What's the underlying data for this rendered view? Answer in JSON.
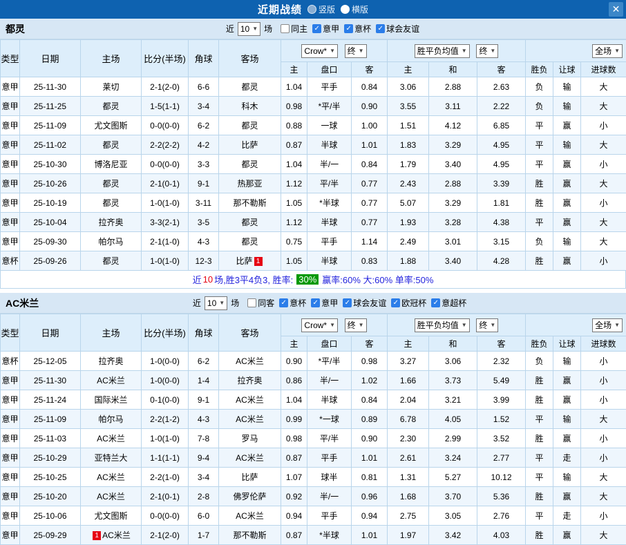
{
  "titlebar": {
    "title": "近期战绩",
    "radio_vertical": "竖版",
    "radio_horizontal": "横版",
    "selected_layout": "横版"
  },
  "icons": {
    "dropdown_arrow": "▼",
    "check_icon": "✓",
    "close_icon": "✕"
  },
  "colors": {
    "accent_blue": "#0e62b0",
    "header_bg": "#ddeefb",
    "team_green": "#089b2d",
    "win_red": "#e60012",
    "draw_blue": "#2222e0",
    "cup_purple": "#8833cc",
    "rate_badge_green": "#009900"
  },
  "columns": {
    "type": "类型",
    "date": "日期",
    "home": "主场",
    "score": "比分(半场)",
    "corner": "角球",
    "away": "客场",
    "sub": [
      "主",
      "盘口",
      "客",
      "主",
      "和",
      "客",
      "胜负",
      "让球",
      "进球数"
    ],
    "dd_crown": "Crow*",
    "dd_final": "终",
    "dd_avg": "胜平负均值",
    "dd_full": "全场"
  },
  "table1": {
    "team": "都灵",
    "near": {
      "label_before": "近",
      "value": "10",
      "label_after": "场"
    },
    "filters": [
      {
        "label": "同主",
        "checked": false
      },
      {
        "label": "意甲",
        "checked": true
      },
      {
        "label": "意杯",
        "checked": true
      },
      {
        "label": "球会友谊",
        "checked": true
      }
    ],
    "rows": [
      {
        "type": "意甲",
        "type_c": "b",
        "date": "25-11-30",
        "home": "莱切",
        "home_focal": false,
        "home_badge": "",
        "score": "2-1(2-0)",
        "score_c": "r",
        "corner": "6-6",
        "away": "都灵",
        "away_focal": true,
        "away_badge": "",
        "odds": [
          "1.04",
          "平手",
          "0.84"
        ],
        "avg": [
          "3.06",
          "2.88",
          "2.63"
        ],
        "res": "负",
        "res_c": "g",
        "let": "输",
        "let_c": "g",
        "goal": "大",
        "goal_c": "r"
      },
      {
        "type": "意甲",
        "type_c": "b",
        "date": "25-11-25",
        "home": "都灵",
        "home_focal": true,
        "home_badge": "",
        "score": "1-5(1-1)",
        "score_c": "r",
        "corner": "3-4",
        "away": "科木",
        "away_focal": false,
        "away_badge": "",
        "odds": [
          "0.98",
          "*平/半",
          "0.90"
        ],
        "avg": [
          "3.55",
          "3.11",
          "2.22"
        ],
        "res": "负",
        "res_c": "g",
        "let": "输",
        "let_c": "g",
        "goal": "大",
        "goal_c": "r"
      },
      {
        "type": "意甲",
        "type_c": "b",
        "date": "25-11-09",
        "home": "尤文图斯",
        "home_focal": false,
        "home_badge": "",
        "score": "0-0(0-0)",
        "score_c": "b",
        "corner": "6-2",
        "away": "都灵",
        "away_focal": true,
        "away_badge": "",
        "odds": [
          "0.88",
          "一球",
          "1.00"
        ],
        "avg": [
          "1.51",
          "4.12",
          "6.85"
        ],
        "res": "平",
        "res_c": "b",
        "let": "赢",
        "let_c": "r",
        "goal": "小",
        "goal_c": "g"
      },
      {
        "type": "意甲",
        "type_c": "b",
        "date": "25-11-02",
        "home": "都灵",
        "home_focal": true,
        "home_badge": "",
        "score": "2-2(2-2)",
        "score_c": "r",
        "corner": "4-2",
        "away": "比萨",
        "away_focal": false,
        "away_badge": "",
        "odds": [
          "0.87",
          "半球",
          "1.01"
        ],
        "avg": [
          "1.83",
          "3.29",
          "4.95"
        ],
        "res": "平",
        "res_c": "b",
        "let": "输",
        "let_c": "g",
        "goal": "大",
        "goal_c": "r"
      },
      {
        "type": "意甲",
        "type_c": "b",
        "date": "25-10-30",
        "home": "博洛尼亚",
        "home_focal": false,
        "home_badge": "",
        "score": "0-0(0-0)",
        "score_c": "b",
        "corner": "3-3",
        "away": "都灵",
        "away_focal": true,
        "away_badge": "",
        "odds": [
          "1.04",
          "半/一",
          "0.84"
        ],
        "avg": [
          "1.79",
          "3.40",
          "4.95"
        ],
        "res": "平",
        "res_c": "b",
        "let": "赢",
        "let_c": "r",
        "goal": "小",
        "goal_c": "g"
      },
      {
        "type": "意甲",
        "type_c": "b",
        "date": "25-10-26",
        "home": "都灵",
        "home_focal": true,
        "home_badge": "",
        "score": "2-1(0-1)",
        "score_c": "r",
        "corner": "9-1",
        "away": "热那亚",
        "away_focal": false,
        "away_badge": "",
        "odds": [
          "1.12",
          "平/半",
          "0.77"
        ],
        "avg": [
          "2.43",
          "2.88",
          "3.39"
        ],
        "res": "胜",
        "res_c": "r",
        "let": "赢",
        "let_c": "r",
        "goal": "大",
        "goal_c": "r"
      },
      {
        "type": "意甲",
        "type_c": "b",
        "date": "25-10-19",
        "home": "都灵",
        "home_focal": true,
        "home_badge": "",
        "score": "1-0(1-0)",
        "score_c": "r",
        "corner": "3-11",
        "away": "那不勒斯",
        "away_focal": false,
        "away_badge": "",
        "odds": [
          "1.05",
          "*半球",
          "0.77"
        ],
        "avg": [
          "5.07",
          "3.29",
          "1.81"
        ],
        "res": "胜",
        "res_c": "r",
        "let": "赢",
        "let_c": "r",
        "goal": "小",
        "goal_c": "g"
      },
      {
        "type": "意甲",
        "type_c": "b",
        "date": "25-10-04",
        "home": "拉齐奥",
        "home_focal": false,
        "home_badge": "",
        "score": "3-3(2-1)",
        "score_c": "r",
        "corner": "3-5",
        "away": "都灵",
        "away_focal": true,
        "away_badge": "",
        "odds": [
          "1.12",
          "半球",
          "0.77"
        ],
        "avg": [
          "1.93",
          "3.28",
          "4.38"
        ],
        "res": "平",
        "res_c": "b",
        "let": "赢",
        "let_c": "r",
        "goal": "大",
        "goal_c": "r"
      },
      {
        "type": "意甲",
        "type_c": "b",
        "date": "25-09-30",
        "home": "帕尔马",
        "home_focal": false,
        "home_badge": "",
        "score": "2-1(1-0)",
        "score_c": "r",
        "corner": "4-3",
        "away": "都灵",
        "away_focal": true,
        "away_badge": "",
        "odds": [
          "0.75",
          "平手",
          "1.14"
        ],
        "avg": [
          "2.49",
          "3.01",
          "3.15"
        ],
        "res": "负",
        "res_c": "g",
        "let": "输",
        "let_c": "g",
        "goal": "大",
        "goal_c": "r"
      },
      {
        "type": "意杯",
        "type_c": "p",
        "date": "25-09-26",
        "home": "都灵",
        "home_focal": true,
        "home_badge": "",
        "score": "1-0(1-0)",
        "score_c": "r",
        "corner": "12-3",
        "away": "比萨",
        "away_focal": false,
        "away_badge": "1",
        "odds": [
          "1.05",
          "半球",
          "0.83"
        ],
        "avg": [
          "1.88",
          "3.40",
          "4.28"
        ],
        "res": "胜",
        "res_c": "r",
        "let": "赢",
        "let_c": "r",
        "goal": "小",
        "goal_c": "g"
      }
    ],
    "summary": {
      "prefix": "近",
      "count": "10",
      "mid": "场,胜3平4负3, 胜率:",
      "rate": "30%",
      "tail": "赢率:60% 大:60% 单率:50%"
    }
  },
  "table2": {
    "team": "AC米兰",
    "near": {
      "label_before": "近",
      "value": "10",
      "label_after": "场"
    },
    "filters": [
      {
        "label": "同客",
        "checked": false
      },
      {
        "label": "意杯",
        "checked": true
      },
      {
        "label": "意甲",
        "checked": true
      },
      {
        "label": "球会友谊",
        "checked": true
      },
      {
        "label": "欧冠杯",
        "checked": true
      },
      {
        "label": "意超杯",
        "checked": true
      }
    ],
    "rows": [
      {
        "type": "意杯",
        "type_c": "p",
        "date": "25-12-05",
        "home": "拉齐奥",
        "home_focal": false,
        "home_badge": "",
        "score": "1-0(0-0)",
        "score_c": "r",
        "corner": "6-2",
        "away": "AC米兰",
        "away_focal": true,
        "away_badge": "",
        "odds": [
          "0.90",
          "*平/半",
          "0.98"
        ],
        "avg": [
          "3.27",
          "3.06",
          "2.32"
        ],
        "res": "负",
        "res_c": "g",
        "let": "输",
        "let_c": "g",
        "goal": "小",
        "goal_c": "g"
      },
      {
        "type": "意甲",
        "type_c": "b",
        "date": "25-11-30",
        "home": "AC米兰",
        "home_focal": true,
        "home_badge": "",
        "score": "1-0(0-0)",
        "score_c": "r",
        "corner": "1-4",
        "away": "拉齐奥",
        "away_focal": false,
        "away_badge": "",
        "odds": [
          "0.86",
          "半/一",
          "1.02"
        ],
        "avg": [
          "1.66",
          "3.73",
          "5.49"
        ],
        "res": "胜",
        "res_c": "r",
        "let": "赢",
        "let_c": "r",
        "goal": "小",
        "goal_c": "g"
      },
      {
        "type": "意甲",
        "type_c": "b",
        "date": "25-11-24",
        "home": "国际米兰",
        "home_focal": false,
        "home_badge": "",
        "score": "0-1(0-0)",
        "score_c": "r",
        "corner": "9-1",
        "away": "AC米兰",
        "away_focal": true,
        "away_badge": "",
        "odds": [
          "1.04",
          "半球",
          "0.84"
        ],
        "avg": [
          "2.04",
          "3.21",
          "3.99"
        ],
        "res": "胜",
        "res_c": "r",
        "let": "赢",
        "let_c": "r",
        "goal": "小",
        "goal_c": "g"
      },
      {
        "type": "意甲",
        "type_c": "b",
        "date": "25-11-09",
        "home": "帕尔马",
        "home_focal": false,
        "home_badge": "",
        "score": "2-2(1-2)",
        "score_c": "r",
        "corner": "4-3",
        "away": "AC米兰",
        "away_focal": true,
        "away_badge": "",
        "odds": [
          "0.99",
          "*一球",
          "0.89"
        ],
        "avg": [
          "6.78",
          "4.05",
          "1.52"
        ],
        "res": "平",
        "res_c": "b",
        "let": "输",
        "let_c": "g",
        "goal": "大",
        "goal_c": "r"
      },
      {
        "type": "意甲",
        "type_c": "b",
        "date": "25-11-03",
        "home": "AC米兰",
        "home_focal": true,
        "home_badge": "",
        "score": "1-0(1-0)",
        "score_c": "r",
        "corner": "7-8",
        "away": "罗马",
        "away_focal": false,
        "away_badge": "",
        "odds": [
          "0.98",
          "平/半",
          "0.90"
        ],
        "avg": [
          "2.30",
          "2.99",
          "3.52"
        ],
        "res": "胜",
        "res_c": "r",
        "let": "赢",
        "let_c": "r",
        "goal": "小",
        "goal_c": "g"
      },
      {
        "type": "意甲",
        "type_c": "b",
        "date": "25-10-29",
        "home": "亚特兰大",
        "home_focal": false,
        "home_badge": "",
        "score": "1-1(1-1)",
        "score_c": "r",
        "corner": "9-4",
        "away": "AC米兰",
        "away_focal": true,
        "away_badge": "",
        "odds": [
          "0.87",
          "平手",
          "1.01"
        ],
        "avg": [
          "2.61",
          "3.24",
          "2.77"
        ],
        "res": "平",
        "res_c": "b",
        "let": "走",
        "let_c": "b",
        "goal": "小",
        "goal_c": "g"
      },
      {
        "type": "意甲",
        "type_c": "b",
        "date": "25-10-25",
        "home": "AC米兰",
        "home_focal": true,
        "home_badge": "",
        "score": "2-2(1-0)",
        "score_c": "r",
        "corner": "3-4",
        "away": "比萨",
        "away_focal": false,
        "away_badge": "",
        "odds": [
          "1.07",
          "球半",
          "0.81"
        ],
        "avg": [
          "1.31",
          "5.27",
          "10.12"
        ],
        "res": "平",
        "res_c": "b",
        "let": "输",
        "let_c": "g",
        "goal": "大",
        "goal_c": "r"
      },
      {
        "type": "意甲",
        "type_c": "b",
        "date": "25-10-20",
        "home": "AC米兰",
        "home_focal": true,
        "home_badge": "",
        "score": "2-1(0-1)",
        "score_c": "r",
        "corner": "2-8",
        "away": "佛罗伦萨",
        "away_focal": false,
        "away_badge": "",
        "odds": [
          "0.92",
          "半/一",
          "0.96"
        ],
        "avg": [
          "1.68",
          "3.70",
          "5.36"
        ],
        "res": "胜",
        "res_c": "r",
        "let": "赢",
        "let_c": "r",
        "goal": "大",
        "goal_c": "r"
      },
      {
        "type": "意甲",
        "type_c": "b",
        "date": "25-10-06",
        "home": "尤文图斯",
        "home_focal": false,
        "home_badge": "",
        "score": "0-0(0-0)",
        "score_c": "b",
        "corner": "6-0",
        "away": "AC米兰",
        "away_focal": true,
        "away_badge": "",
        "odds": [
          "0.94",
          "平手",
          "0.94"
        ],
        "avg": [
          "2.75",
          "3.05",
          "2.76"
        ],
        "res": "平",
        "res_c": "b",
        "let": "走",
        "let_c": "b",
        "goal": "小",
        "goal_c": "g"
      },
      {
        "type": "意甲",
        "type_c": "b",
        "date": "25-09-29",
        "home": "AC米兰",
        "home_focal": true,
        "home_badge": "1",
        "score": "2-1(2-0)",
        "score_c": "r",
        "corner": "1-7",
        "away": "那不勒斯",
        "away_focal": false,
        "away_badge": "",
        "odds": [
          "0.87",
          "*半球",
          "1.01"
        ],
        "avg": [
          "1.97",
          "3.42",
          "4.03"
        ],
        "res": "胜",
        "res_c": "r",
        "let": "赢",
        "let_c": "r",
        "goal": "大",
        "goal_c": "r"
      }
    ]
  }
}
